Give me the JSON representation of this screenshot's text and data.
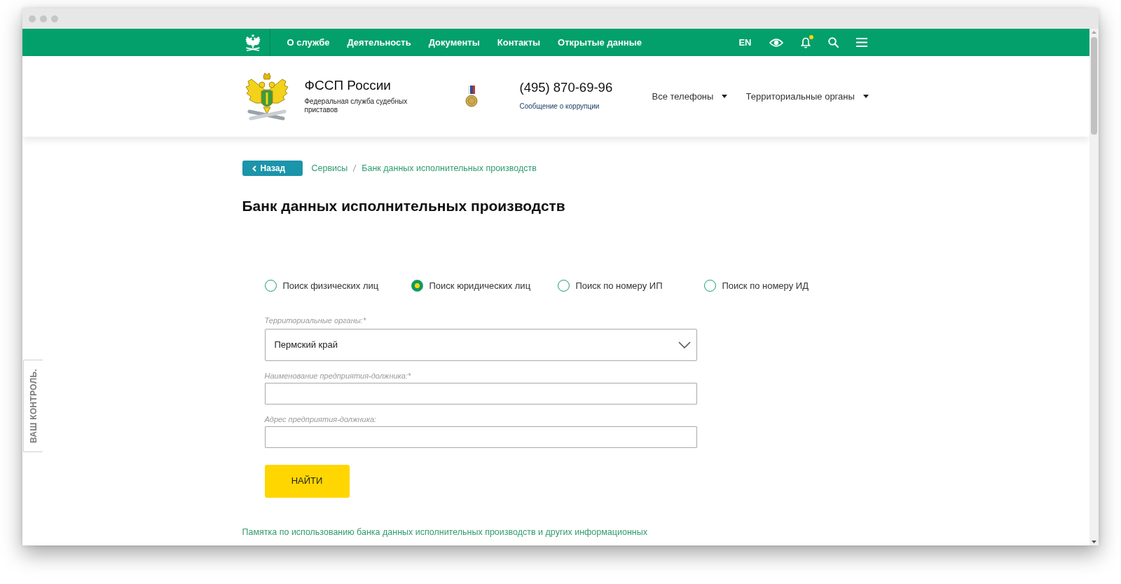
{
  "top_nav": {
    "links": [
      "О службе",
      "Деятельность",
      "Документы",
      "Контакты",
      "Открытые данные"
    ],
    "language": "EN",
    "has_notifications": true
  },
  "header": {
    "title": "ФССП России",
    "subtitle": "Федеральная служба судебных приставов",
    "phone": "(495) 870-69-96",
    "phone_note": "Сообщение о коррупции",
    "dropdowns": [
      "Все телефоны",
      "Территориальные органы"
    ]
  },
  "back_button": "Назад",
  "breadcrumb": [
    "Сервисы",
    "Банк данных исполнительных производств"
  ],
  "title": "Банк данных исполнительных производств",
  "search_modes": [
    {
      "label": "Поиск физических лиц",
      "selected": false
    },
    {
      "label": "Поиск юридических лиц",
      "selected": true
    },
    {
      "label": "Поиск по номеру ИП",
      "selected": false
    },
    {
      "label": "Поиск по номеру ИД",
      "selected": false
    }
  ],
  "fields": [
    {
      "kind": "select",
      "label": "Территориальные органы:*",
      "value": "Пермский край"
    },
    {
      "kind": "text",
      "label": "Наименование предприятия-должника:*"
    },
    {
      "kind": "text",
      "label": "Адрес предприятия-должника:"
    }
  ],
  "submit_button": "НАЙТИ",
  "help_link": "Памятка по использованию банка данных исполнительных производств и других информационных",
  "side_tab": "ВАШ КОНТРОЛЬ."
}
